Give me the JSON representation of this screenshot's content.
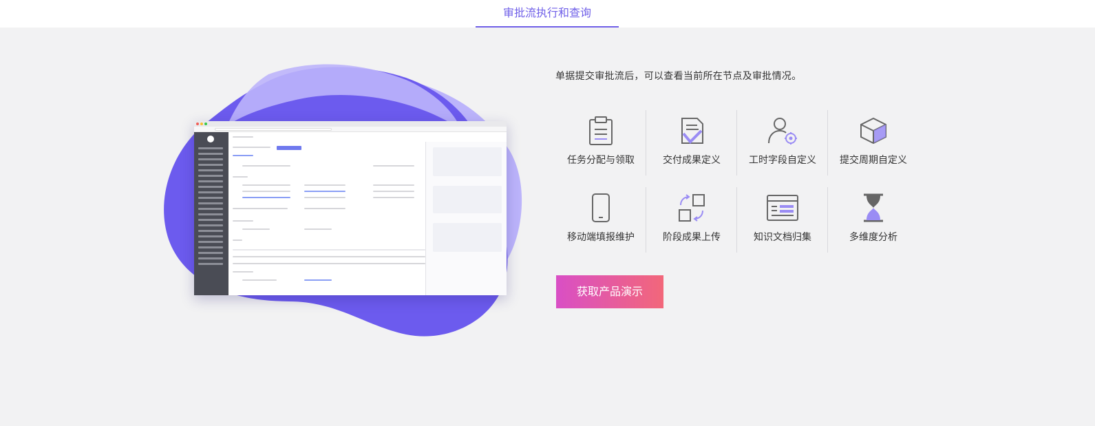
{
  "tab": {
    "label": "审批流执行和查询"
  },
  "description": "单据提交审批流后，可以查看当前所在节点及审批情况。",
  "features": [
    {
      "label": "任务分配与领取",
      "icon": "clipboard-icon"
    },
    {
      "label": "交付成果定义",
      "icon": "document-check-icon"
    },
    {
      "label": "工时字段自定义",
      "icon": "user-gear-icon"
    },
    {
      "label": "提交周期自定义",
      "icon": "cube-icon"
    },
    {
      "label": "移动端填报维护",
      "icon": "mobile-icon"
    },
    {
      "label": "阶段成果上传",
      "icon": "blocks-upload-icon"
    },
    {
      "label": "知识文档归集",
      "icon": "browser-window-icon"
    },
    {
      "label": "多维度分析",
      "icon": "hourglass-icon"
    }
  ],
  "cta": {
    "label": "获取产品演示"
  },
  "colors": {
    "accent": "#6f5fe8",
    "blob_dark": "#6c5bee",
    "blob_light": "#bcb4fb",
    "cta_start": "#d94fc5",
    "cta_end": "#f2677a"
  }
}
